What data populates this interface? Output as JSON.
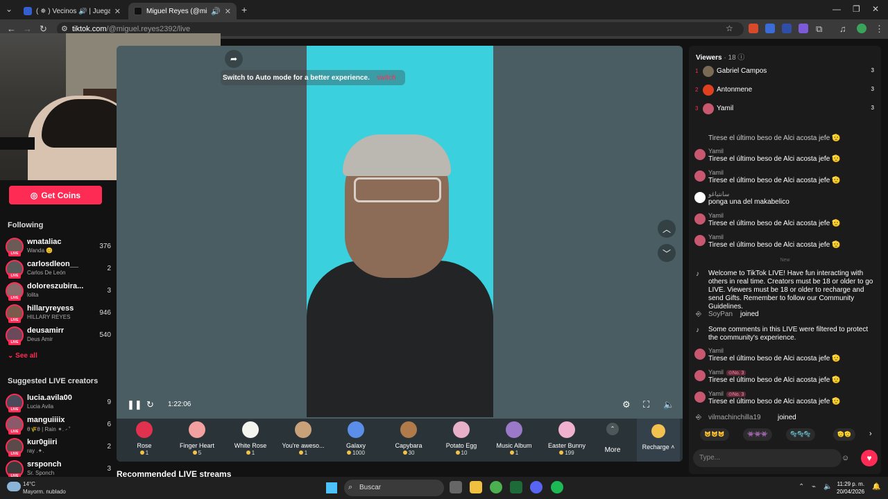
{
  "browser": {
    "tabs": [
      {
        "title": "( ✵ ) Vecinos 🔊 | Juega en Roblox",
        "active": false
      },
      {
        "title": "Miguel Reyes (@miguel",
        "active": true
      }
    ],
    "url_domain": "tiktok.com",
    "url_path": "/@miguel.reyes2392/live"
  },
  "sidebar": {
    "get_coins": "Get Coins",
    "following_title": "Following",
    "following": [
      {
        "name": "wnataliac",
        "sub": "Wanda 😊",
        "count": "376"
      },
      {
        "name": "carlosdleon__",
        "sub": "Carlos De León",
        "count": "2"
      },
      {
        "name": "doloreszubira...",
        "sub": "lolita",
        "count": "3"
      },
      {
        "name": "hillaryreyess",
        "sub": "HILLARY REYES",
        "count": "946"
      },
      {
        "name": "deusamirr",
        "sub": "Deus Amir",
        "count": "540"
      }
    ],
    "see_all": "See all",
    "suggested_title": "Suggested LIVE creators",
    "suggested": [
      {
        "name": "lucia.avila00",
        "sub": "Lucia Avila",
        "count": "9"
      },
      {
        "name": "manguiiiix",
        "sub": "θ🌾θ | Rain ✶. ⹝ ˚",
        "count": "6"
      },
      {
        "name": "kur0giiri",
        "sub": "ray .✦.",
        "count": "2"
      },
      {
        "name": "srsponch",
        "sub": "Sr. Sponch",
        "count": "3"
      }
    ]
  },
  "player": {
    "hint_text": "Switch to Auto mode for a better experience.",
    "hint_action": "switch",
    "timecode": "1:22:06",
    "gifts": [
      {
        "name": "Rose",
        "price": "1",
        "color": "#e0314f"
      },
      {
        "name": "Finger Heart",
        "price": "5",
        "color": "#f2a0a0"
      },
      {
        "name": "White Rose",
        "price": "1",
        "color": "#f5f5f0"
      },
      {
        "name": "You're aweso...",
        "price": "1",
        "color": "#c9a27a"
      },
      {
        "name": "Galaxy",
        "price": "1000",
        "color": "#5a8ee8"
      },
      {
        "name": "Capybara",
        "price": "30",
        "color": "#b07a4a"
      },
      {
        "name": "Potato Egg",
        "price": "10",
        "color": "#e8b0c8"
      },
      {
        "name": "Music Album",
        "price": "1",
        "color": "#9a7ac8"
      },
      {
        "name": "Easter Bunny",
        "price": "199",
        "color": "#f0b0d0"
      }
    ],
    "more_label": "More",
    "recharge_label": "Recharge ˄"
  },
  "recommended_title": "Recommended LIVE streams",
  "chat": {
    "viewers_label": "Viewers",
    "viewers_count": "· 18",
    "top_viewers": [
      {
        "rank": "1",
        "name": "Gabriel Campos",
        "score": "3",
        "color": "#7a6a55"
      },
      {
        "rank": "2",
        "name": "Antonmene",
        "score": "3",
        "color": "#e04020"
      },
      {
        "rank": "3",
        "name": "Yamil",
        "score": "3",
        "color": "#c85870"
      }
    ],
    "top_cut_text": "Tirese el último beso de Alci acosta jefe 🫡",
    "messages_before": [
      {
        "user": "Yamil",
        "text": "Tirese el último beso de Alci acosta jefe 🫡"
      },
      {
        "user": "Yamil",
        "text": "Tirese el último beso de Alci acosta jefe 🫡"
      },
      {
        "user": "سانتياغو",
        "text": "ponga una del makabelico"
      },
      {
        "user": "Yamil",
        "text": "Tirese el último beso de Alci acosta jefe 🫡"
      },
      {
        "user": "Yamil",
        "text": "Tirese el último beso de Alci acosta jefe 🫡"
      }
    ],
    "new_label": "New",
    "welcome_text": "Welcome to TikTok LIVE! Have fun interacting with others in real time. Creators must be 18 or older to go LIVE. Viewers must be 18 or older to recharge and send Gifts. Remember to follow our Community Guidelines.",
    "join1_user": "SoyPan",
    "join_word": "joined",
    "filter_text": "Some comments in this LIVE were filtered to protect the community's experience.",
    "messages_after": [
      {
        "user": "Yamil",
        "badge": "",
        "text": "Tirese el último beso de Alci acosta jefe 🫡"
      },
      {
        "user": "Yamil",
        "badge": "⊙No. 3",
        "text": "Tirese el último beso de Alci acosta jefe 🫡"
      },
      {
        "user": "Yamil",
        "badge": "⊙No. 3",
        "text": "Tirese el último beso de Alci acosta jefe 🫡"
      }
    ],
    "join2_user": "vilmachinchilla19",
    "emoji_chips": [
      "😺😺😺",
      "👾👾👾",
      "🫧🫧🫧",
      "🫡🫡"
    ],
    "input_placeholder": "Type..."
  },
  "taskbar": {
    "temp": "14°C",
    "weather": "Mayorm. nublado",
    "search_placeholder": "Buscar",
    "time": "11:29 p. m.",
    "date": "20/04/2026"
  }
}
